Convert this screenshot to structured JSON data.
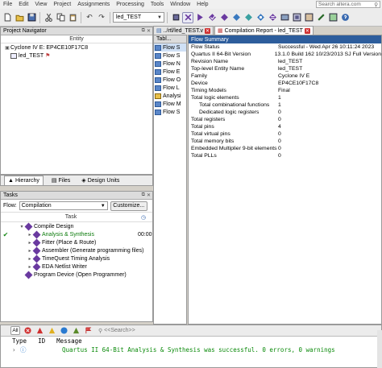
{
  "menubar": {
    "items": [
      "File",
      "Edit",
      "View",
      "Project",
      "Assignments",
      "Processing",
      "Tools",
      "Window",
      "Help"
    ],
    "search_placeholder": "Search altera.com"
  },
  "toolbar": {
    "project_value": "led_TEST",
    "icons": [
      "new-file-icon",
      "open-icon",
      "save-icon",
      "cut-icon",
      "copy-icon",
      "paste-icon",
      "undo-icon",
      "redo-icon",
      "project-combo",
      "stop-icon",
      "compile-icon",
      "analysis-icon",
      "synthesis-icon",
      "fitter-icon",
      "assembler-icon",
      "timing-icon",
      "rtl-icon",
      "netlist-icon",
      "chip-planner-icon",
      "programmer-icon",
      "pin-planner-icon",
      "settings-icon",
      "help-icon"
    ]
  },
  "navigator": {
    "title": "Project Navigator",
    "column_header": "Entity",
    "device": "Cyclone IV E: EP4CE10F17C8",
    "top_entity": "led_TEST",
    "tabs": [
      "Hierarchy",
      "Files",
      "Design Units"
    ]
  },
  "tasks": {
    "title": "Tasks",
    "flow_label": "Flow:",
    "flow_value": "Compilation",
    "customize_label": "Customize...",
    "column_task": "Task",
    "items": [
      {
        "indent": 1,
        "label": "Compile Design",
        "status": "",
        "time": "",
        "color": "#000000",
        "expander": "▾"
      },
      {
        "indent": 2,
        "label": "Analysis & Synthesis",
        "status": "✔",
        "time": "00:00",
        "color": "#0a7a0a",
        "expander": "▸"
      },
      {
        "indent": 2,
        "label": "Fitter (Place & Route)",
        "status": "",
        "time": "",
        "color": "#000000",
        "expander": "▸"
      },
      {
        "indent": 2,
        "label": "Assembler (Generate programming files)",
        "status": "",
        "time": "",
        "color": "#000000",
        "expander": "▸"
      },
      {
        "indent": 2,
        "label": "TimeQuest Timing Analysis",
        "status": "",
        "time": "",
        "color": "#000000",
        "expander": "▸"
      },
      {
        "indent": 2,
        "label": "EDA Netlist Writer",
        "status": "",
        "time": "",
        "color": "#000000",
        "expander": "▸"
      },
      {
        "indent": 1,
        "label": "Program Device (Open Programmer)",
        "status": "",
        "time": "",
        "color": "#000000",
        "expander": ""
      }
    ]
  },
  "tables": {
    "title": "Tabl...",
    "items": [
      "Flow S",
      "Flow S",
      "Flow N",
      "Flow E",
      "Flow O",
      "Flow L",
      "Analysi",
      "Flow M",
      "Flow S"
    ]
  },
  "doc_tabs": [
    {
      "label": "../rtl/led_TEST.v",
      "active": false
    },
    {
      "label": "Compilation Report - led_TEST",
      "active": true
    }
  ],
  "summary": {
    "title": "Flow Summary",
    "rows": [
      {
        "k": "Flow Status",
        "v": "Successful - Wed Apr 26 10:11:24 2023",
        "ind": false
      },
      {
        "k": "Quartus II 64-Bit Version",
        "v": "13.1.0 Build 162 10/23/2013 SJ Full Version",
        "ind": false
      },
      {
        "k": "Revision Name",
        "v": "led_TEST",
        "ind": false
      },
      {
        "k": "Top-level Entity Name",
        "v": "led_TEST",
        "ind": false
      },
      {
        "k": "Family",
        "v": "Cyclone IV E",
        "ind": false
      },
      {
        "k": "Device",
        "v": "EP4CE10F17C8",
        "ind": false
      },
      {
        "k": "Timing Models",
        "v": "Final",
        "ind": false
      },
      {
        "k": "Total logic elements",
        "v": "1",
        "ind": false
      },
      {
        "k": "Total combinational functions",
        "v": "1",
        "ind": true
      },
      {
        "k": "Dedicated logic registers",
        "v": "0",
        "ind": true
      },
      {
        "k": "Total registers",
        "v": "0",
        "ind": false
      },
      {
        "k": "Total pins",
        "v": "4",
        "ind": false
      },
      {
        "k": "Total virtual pins",
        "v": "0",
        "ind": false
      },
      {
        "k": "Total memory bits",
        "v": "0",
        "ind": false
      },
      {
        "k": "Embedded Multiplier 9-bit elements",
        "v": "0",
        "ind": false
      },
      {
        "k": "Total PLLs",
        "v": "0",
        "ind": false
      }
    ]
  },
  "messages": {
    "filter_all": "All",
    "search_placeholder": "<<Search>>",
    "col_type": "Type",
    "col_id": "ID",
    "col_message": "Message",
    "row_text": "Quartus II 64-Bit Analysis & Synthesis was successful. 0 errors, 0 warnings"
  }
}
